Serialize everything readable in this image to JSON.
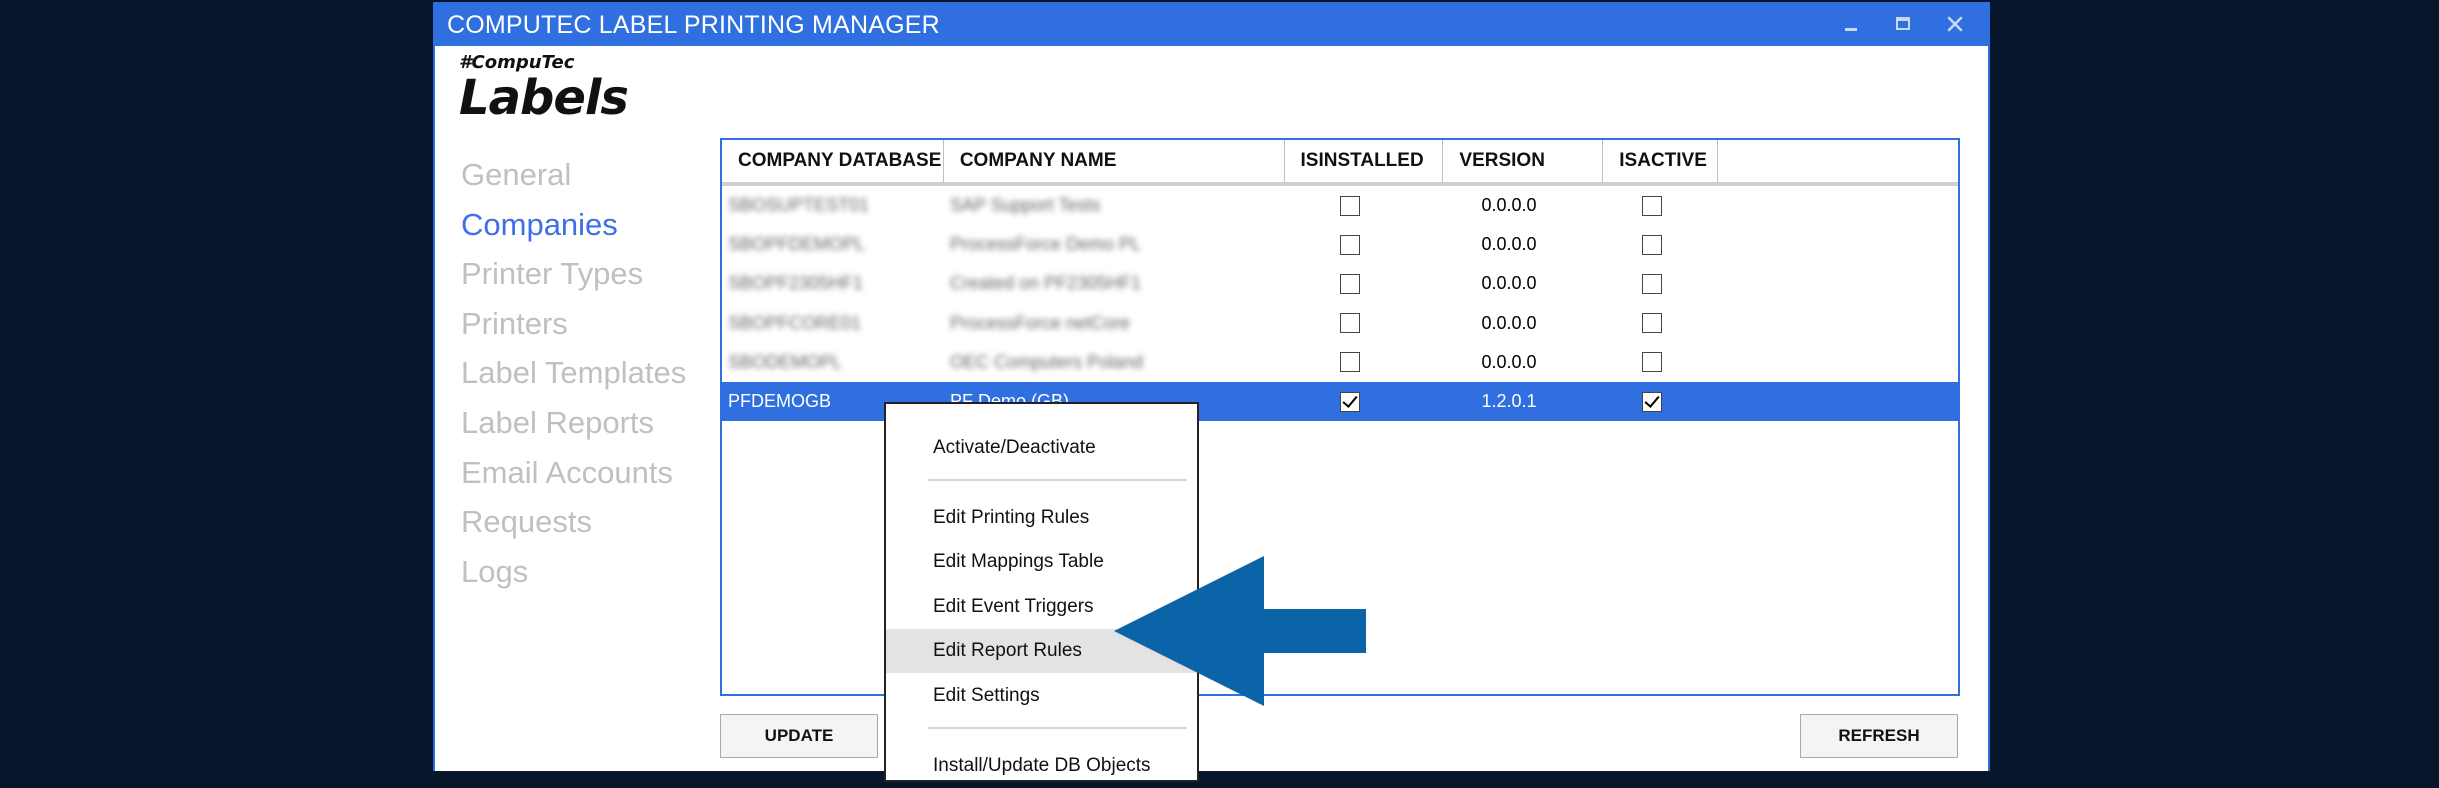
{
  "theme": {
    "background": "#07162a",
    "accent": "#2f6fe0",
    "selection": "#2f6fe0",
    "arrow": "#0b63a8"
  },
  "window": {
    "title": "COMPUTEC LABEL PRINTING MANAGER",
    "controls": [
      "minimize-icon",
      "maximize-icon",
      "close-icon"
    ]
  },
  "brand": {
    "tagline": "#CompuTec",
    "name": "Labels"
  },
  "nav": {
    "items": [
      {
        "label": "General"
      },
      {
        "label": "Companies",
        "active": true
      },
      {
        "label": "Printer Types"
      },
      {
        "label": "Printers"
      },
      {
        "label": "Label Templates"
      },
      {
        "label": "Label Reports"
      },
      {
        "label": "Email Accounts"
      },
      {
        "label": "Requests"
      },
      {
        "label": "Logs"
      }
    ]
  },
  "grid": {
    "columns": [
      "COMPANY DATABASE",
      "COMPANY NAME",
      "ISINSTALLED",
      "VERSION",
      "ISACTIVE"
    ],
    "rows": [
      {
        "db": "SBOSUPTEST01",
        "name": "SAP Support Tests",
        "installed": false,
        "version": "0.0.0.0",
        "active": false
      },
      {
        "db": "SBOPFDEMOPL",
        "name": "ProcessForce Demo PL",
        "installed": false,
        "version": "0.0.0.0",
        "active": false
      },
      {
        "db": "SBOPF2305HF1",
        "name": "Created on PF2305HF1",
        "installed": false,
        "version": "0.0.0.0",
        "active": false
      },
      {
        "db": "SBOPFCORE01",
        "name": "ProcessForce netCore",
        "installed": false,
        "version": "0.0.0.0",
        "active": false
      },
      {
        "db": "SBODEMOPL",
        "name": "OEC Computers Poland",
        "installed": false,
        "version": "0.0.0.0",
        "active": false
      },
      {
        "db": "PFDEMOGB",
        "name": "PF Demo (GB)",
        "installed": true,
        "version": "1.2.0.1",
        "active": true,
        "selected": true
      }
    ]
  },
  "buttons": {
    "update": "UPDATE",
    "refresh": "REFRESH"
  },
  "context_menu": {
    "items": [
      {
        "label": "Activate/Deactivate"
      },
      {
        "label": "Edit Printing Rules"
      },
      {
        "label": "Edit Mappings Table"
      },
      {
        "label": "Edit Event Triggers"
      },
      {
        "label": "Edit Report Rules",
        "highlighted": true
      },
      {
        "label": "Edit Settings"
      },
      {
        "label": "Install/Update DB Objects"
      }
    ]
  }
}
